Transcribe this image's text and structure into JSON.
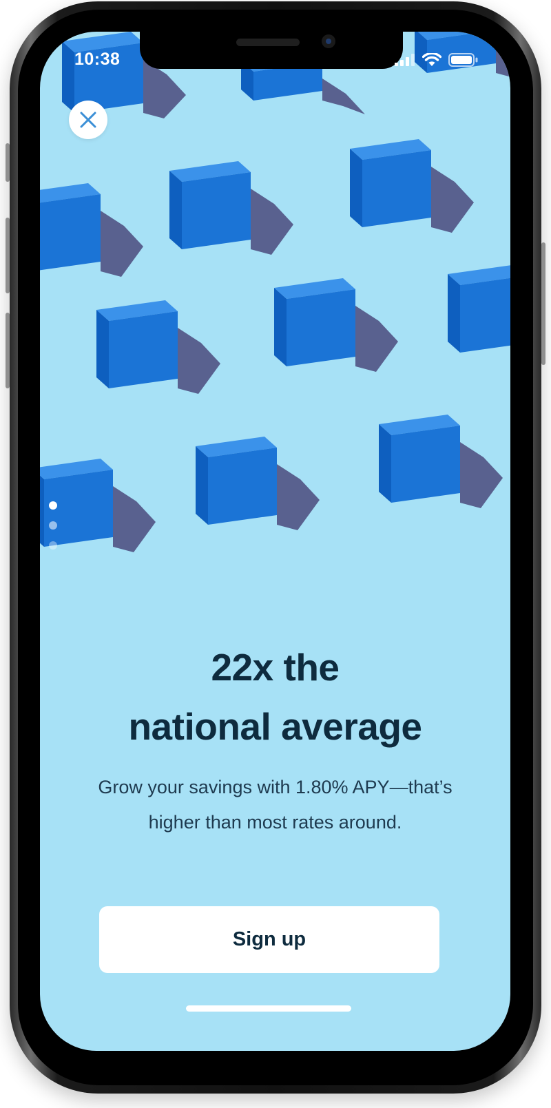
{
  "status_bar": {
    "time": "10:38",
    "icons": [
      "cellular-signal-icon",
      "wifi-icon",
      "battery-icon"
    ],
    "icon_color": "#ffffff"
  },
  "close_button": {
    "icon": "close-icon",
    "icon_color": "#3b8fd6"
  },
  "carousel": {
    "pages": 3,
    "active_index": 0
  },
  "headline": {
    "line1": "22x the",
    "line2": "national average"
  },
  "body": {
    "line1": "Grow your savings with 1.80% APY—that’s",
    "line2": "higher than most rates around."
  },
  "cta": {
    "label": "Sign up"
  },
  "colors": {
    "background": "#a7e1f6",
    "cube_front": "#1b74d6",
    "cube_side": "#0e5fbf",
    "cube_top": "#3b92ea",
    "cube_shadow": "#4b4a7c",
    "headline": "#0e2b3e",
    "button": "#ffffff"
  }
}
